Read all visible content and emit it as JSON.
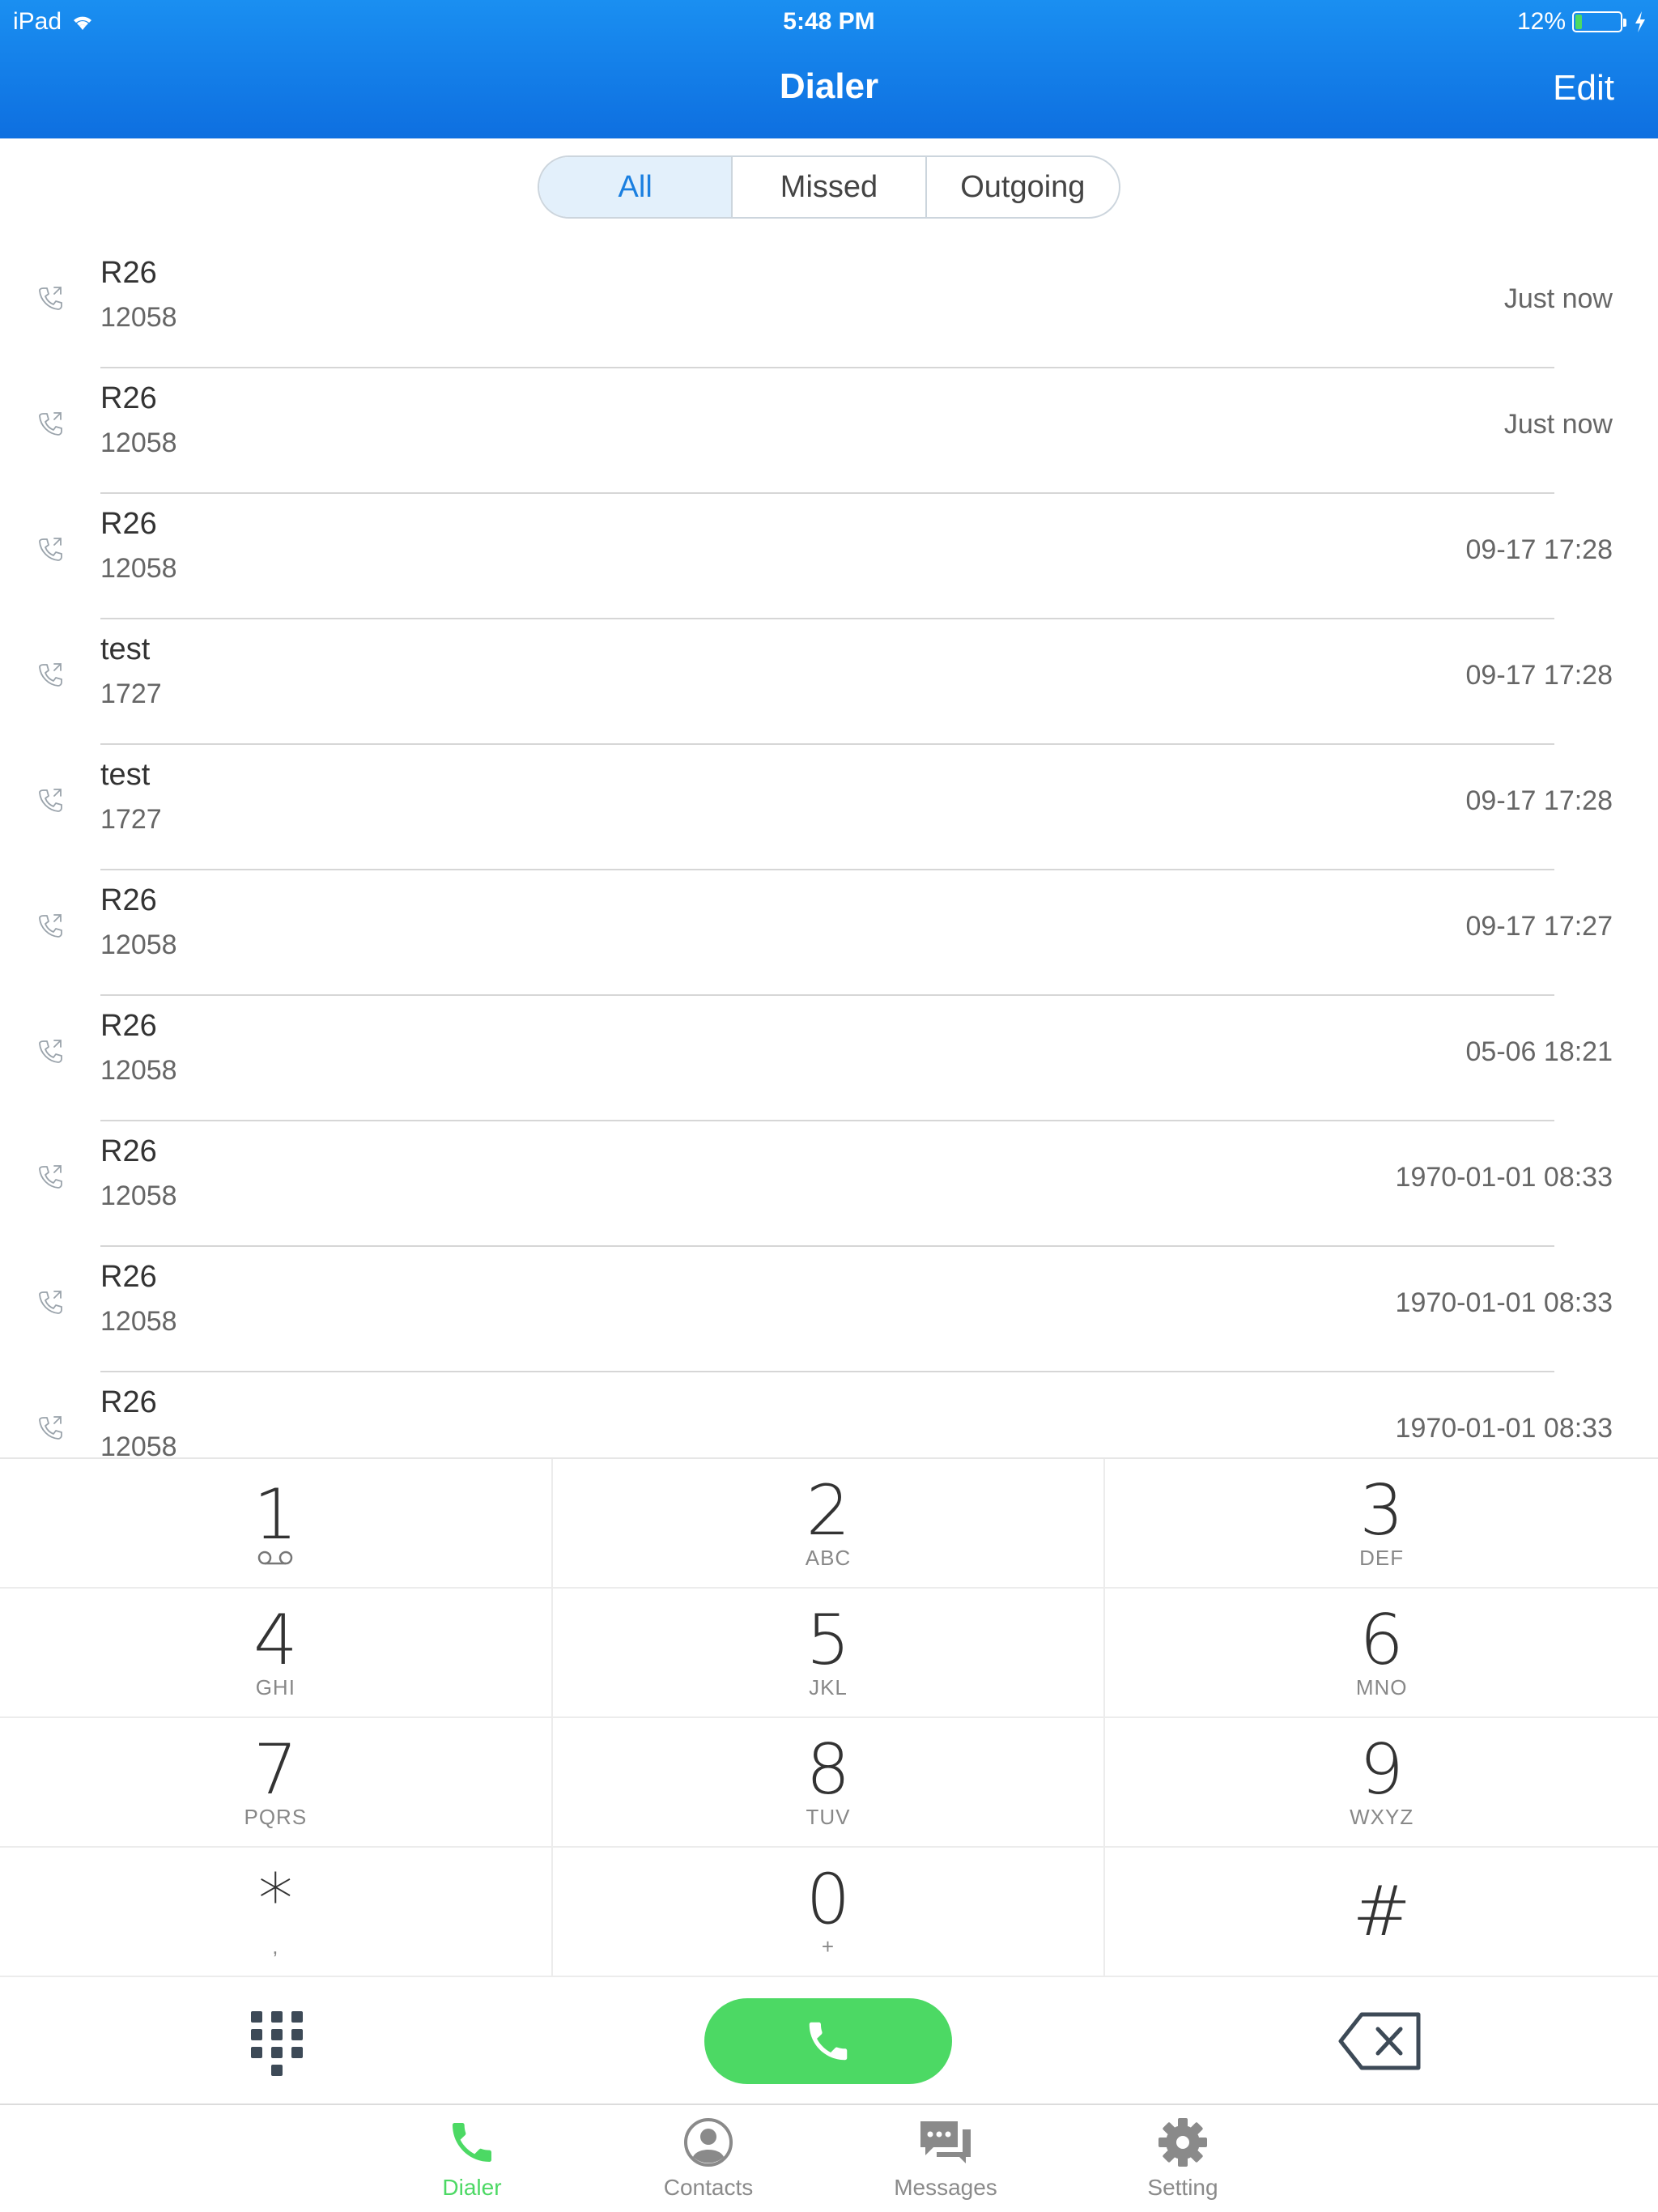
{
  "status_bar": {
    "device": "iPad",
    "time": "5:48 PM",
    "battery": "12%"
  },
  "nav": {
    "title": "Dialer",
    "edit_label": "Edit"
  },
  "segments": [
    {
      "label": "All",
      "active": true
    },
    {
      "label": "Missed",
      "active": false
    },
    {
      "label": "Outgoing",
      "active": false
    }
  ],
  "calls": [
    {
      "name": "R26",
      "number": "12058",
      "time": "Just now"
    },
    {
      "name": "R26",
      "number": "12058",
      "time": "Just now"
    },
    {
      "name": "R26",
      "number": "12058",
      "time": "09-17 17:28"
    },
    {
      "name": "test",
      "number": "1727",
      "time": "09-17 17:28"
    },
    {
      "name": "test",
      "number": "1727",
      "time": "09-17 17:28"
    },
    {
      "name": "R26",
      "number": "12058",
      "time": "09-17 17:27"
    },
    {
      "name": "R26",
      "number": "12058",
      "time": "05-06 18:21"
    },
    {
      "name": "R26",
      "number": "12058",
      "time": "1970-01-01 08:33"
    },
    {
      "name": "R26",
      "number": "12058",
      "time": "1970-01-01 08:33"
    },
    {
      "name": "R26",
      "number": "12058",
      "time": "1970-01-01 08:33"
    }
  ],
  "keypad": [
    {
      "digit": "1",
      "sub": "voicemail-icon"
    },
    {
      "digit": "2",
      "sub": "ABC"
    },
    {
      "digit": "3",
      "sub": "DEF"
    },
    {
      "digit": "4",
      "sub": "GHI"
    },
    {
      "digit": "5",
      "sub": "JKL"
    },
    {
      "digit": "6",
      "sub": "MNO"
    },
    {
      "digit": "7",
      "sub": "PQRS"
    },
    {
      "digit": "8",
      "sub": "TUV"
    },
    {
      "digit": "9",
      "sub": "WXYZ"
    },
    {
      "digit": "*",
      "sub": ","
    },
    {
      "digit": "0",
      "sub": "+"
    },
    {
      "digit": "#",
      "sub": ""
    }
  ],
  "tabs": [
    {
      "label": "Dialer",
      "icon": "phone-icon",
      "active": true
    },
    {
      "label": "Contacts",
      "icon": "person-icon",
      "active": false
    },
    {
      "label": "Messages",
      "icon": "chat-icon",
      "active": false
    },
    {
      "label": "Setting",
      "icon": "gear-icon",
      "active": false
    }
  ],
  "colors": {
    "header": "#1a8ff1",
    "accent": "#4cd964",
    "segment_active": "#1a7fe0"
  }
}
